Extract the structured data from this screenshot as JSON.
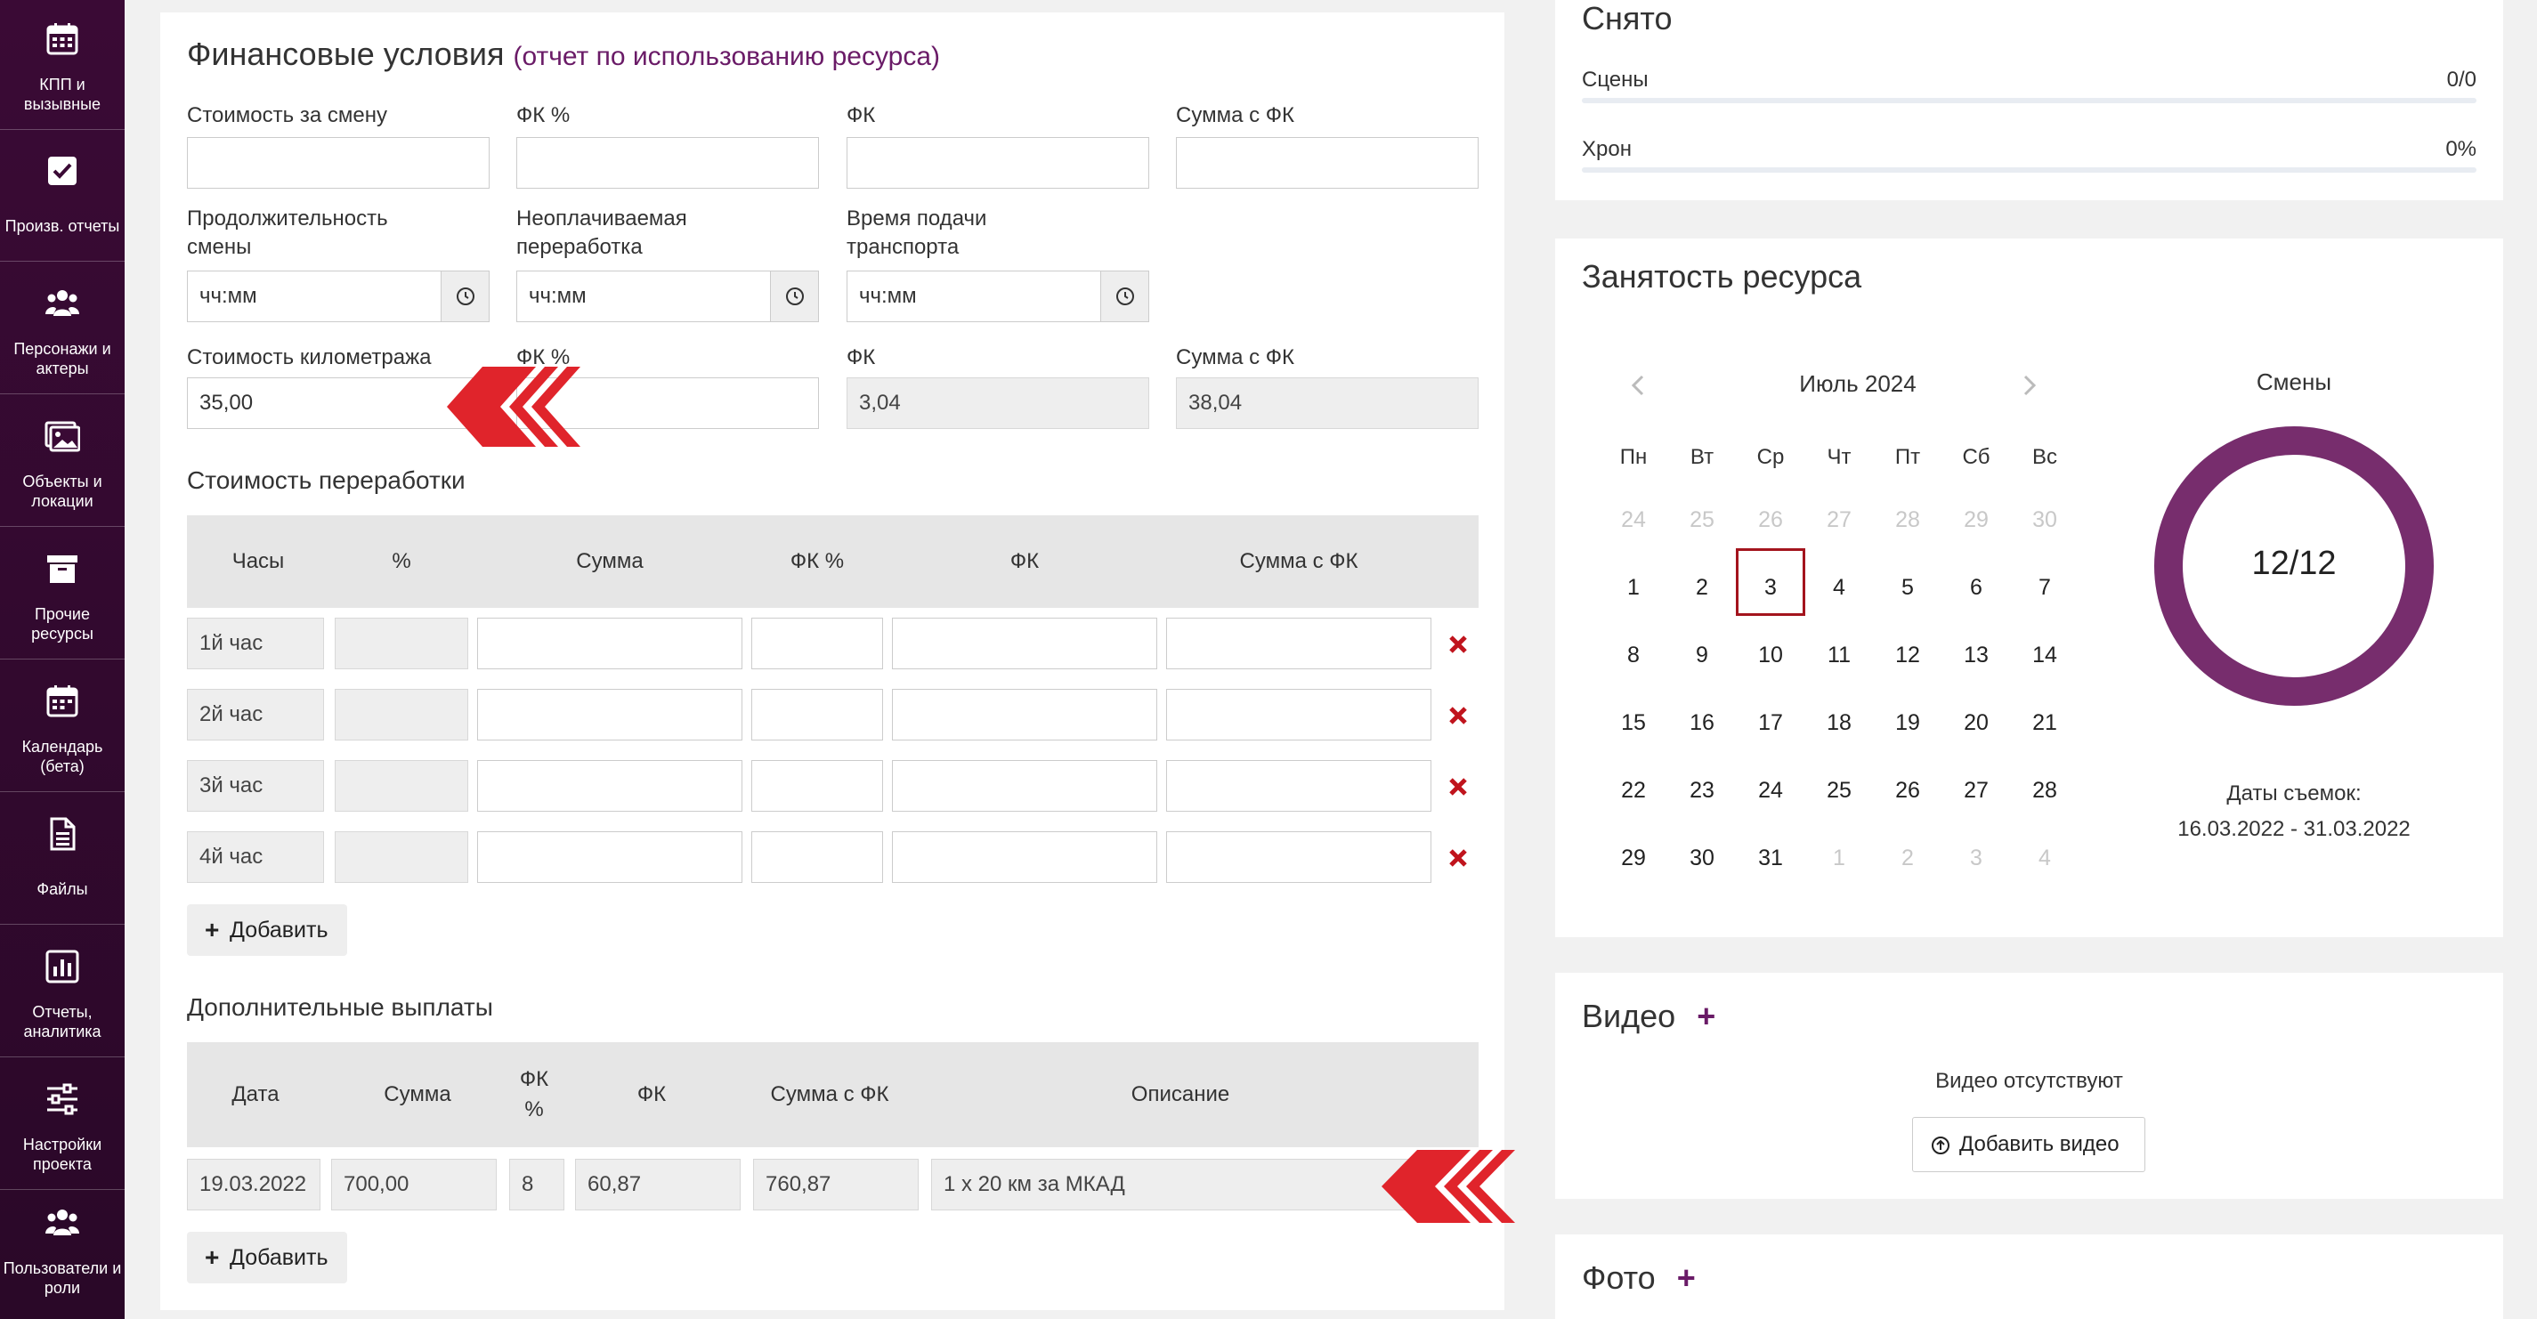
{
  "sidebar": {
    "items": [
      {
        "icon": "calendar-grid-icon",
        "label": "КПП и вызывные"
      },
      {
        "icon": "checkbox-icon",
        "label": "Произв. отчеты"
      },
      {
        "icon": "users-icon",
        "label": "Персонажи и актеры"
      },
      {
        "icon": "image-icon",
        "label": "Объекты и локации"
      },
      {
        "icon": "archive-box-icon",
        "label": "Прочие ресурсы"
      },
      {
        "icon": "calendar-icon",
        "label": "Календарь (бета)"
      },
      {
        "icon": "file-icon",
        "label": "Файлы"
      },
      {
        "icon": "bar-chart-icon",
        "label": "Отчеты, аналитика"
      },
      {
        "icon": "sliders-icon",
        "label": "Настройки проекта"
      },
      {
        "icon": "users-icon",
        "label": "Пользователи и роли"
      }
    ]
  },
  "finance": {
    "title": "Финансовые условия",
    "title_link": "(отчет по использованию ресурса)",
    "row1": {
      "shift_cost_label": "Стоимость за смену",
      "fk_pct_label": "ФК %",
      "fk_label": "ФК",
      "sum_fk_label": "Сумма с ФК"
    },
    "row2": {
      "shift_duration_label": "Продолжительность смены",
      "unpaid_overtime_label": "Неоплачиваемая переработка",
      "transport_time_label": "Время подачи транспорта",
      "time_placeholder": "чч:мм"
    },
    "row3": {
      "mileage_cost_label": "Стоимость километража",
      "mileage_cost_value": "35,00",
      "fk_pct_label": "ФК %",
      "fk_label": "ФК",
      "fk_value": "3,04",
      "sum_fk_label": "Сумма с ФК",
      "sum_fk_value": "38,04"
    }
  },
  "overtime": {
    "title": "Стоимость переработки",
    "columns": [
      "Часы",
      "%",
      "Сумма",
      "ФК %",
      "ФК",
      "Сумма с ФК"
    ],
    "rows": [
      {
        "hour": "1й час"
      },
      {
        "hour": "2й час"
      },
      {
        "hour": "3й час"
      },
      {
        "hour": "4й час"
      }
    ],
    "add_label": "Добавить"
  },
  "extra": {
    "title": "Дополнительные выплаты",
    "columns": [
      "Дата",
      "Сумма",
      "ФК %",
      "ФК",
      "Сумма с ФК",
      "Описание"
    ],
    "rows": [
      {
        "date": "19.03.2022",
        "sum": "700,00",
        "fk_pct": "8",
        "fk": "60,87",
        "sum_fk": "760,87",
        "desc": "1 x 20 км за МКАД"
      }
    ],
    "add_label": "Добавить"
  },
  "filmed": {
    "title": "Снято",
    "scenes_label": "Сцены",
    "scenes_value": "0/0",
    "chron_label": "Хрон",
    "chron_value": "0%"
  },
  "occupancy": {
    "title": "Занятость ресурса",
    "month": "Июль 2024",
    "weekdays": [
      "Пн",
      "Вт",
      "Ср",
      "Чт",
      "Пт",
      "Сб",
      "Вс"
    ],
    "weeks": [
      [
        {
          "d": "24",
          "m": true
        },
        {
          "d": "25",
          "m": true
        },
        {
          "d": "26",
          "m": true
        },
        {
          "d": "27",
          "m": true
        },
        {
          "d": "28",
          "m": true
        },
        {
          "d": "29",
          "m": true
        },
        {
          "d": "30",
          "m": true
        }
      ],
      [
        {
          "d": "1"
        },
        {
          "d": "2"
        },
        {
          "d": "3",
          "today": true
        },
        {
          "d": "4"
        },
        {
          "d": "5"
        },
        {
          "d": "6"
        },
        {
          "d": "7"
        }
      ],
      [
        {
          "d": "8"
        },
        {
          "d": "9"
        },
        {
          "d": "10"
        },
        {
          "d": "11"
        },
        {
          "d": "12"
        },
        {
          "d": "13"
        },
        {
          "d": "14"
        }
      ],
      [
        {
          "d": "15"
        },
        {
          "d": "16"
        },
        {
          "d": "17"
        },
        {
          "d": "18"
        },
        {
          "d": "19"
        },
        {
          "d": "20"
        },
        {
          "d": "21"
        }
      ],
      [
        {
          "d": "22"
        },
        {
          "d": "23"
        },
        {
          "d": "24"
        },
        {
          "d": "25"
        },
        {
          "d": "26"
        },
        {
          "d": "27"
        },
        {
          "d": "28"
        }
      ],
      [
        {
          "d": "29"
        },
        {
          "d": "30"
        },
        {
          "d": "31"
        },
        {
          "d": "1",
          "m": true
        },
        {
          "d": "2",
          "m": true
        },
        {
          "d": "3",
          "m": true
        },
        {
          "d": "4",
          "m": true
        }
      ]
    ],
    "shifts_label": "Смены",
    "shifts_value": "12/12",
    "shifts_fraction": 1.0,
    "dates_label": "Даты съемок:",
    "dates_value": "16.03.2022 - 31.03.2022"
  },
  "video": {
    "title": "Видео",
    "empty": "Видео отсутствуют",
    "add_label": "Добавить видео"
  },
  "photo": {
    "title": "Фото"
  },
  "colors": {
    "sidebar_bg": "#3a0a35",
    "accent_purple": "#6a1b67",
    "ring": "#772d6d",
    "delete_red": "#c0141d",
    "marker_red": "#e0242b"
  }
}
